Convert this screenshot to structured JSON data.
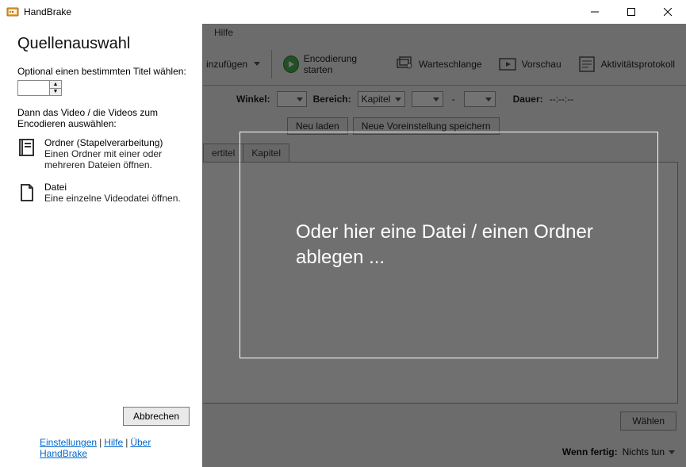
{
  "title": "HandBrake",
  "menu": {
    "help": "Hilfe"
  },
  "toolbar": {
    "open": "inzufügen",
    "encode": "Encodierung starten",
    "queue": "Warteschlange",
    "preview": "Vorschau",
    "activity": "Aktivitätsprotokoll"
  },
  "row1": {
    "angle": "Winkel:",
    "range": "Bereich:",
    "range_val": "Kapitel",
    "duration": "Dauer:",
    "duration_val": "--:--:--"
  },
  "row2": {
    "reload": "Neu laden",
    "save_preset": "Neue Voreinstellung speichern"
  },
  "tabs": {
    "subtitle": "ertitel",
    "chapters": "Kapitel"
  },
  "bottom": {
    "choose": "Wählen"
  },
  "status": {
    "label": "Wenn fertig:",
    "value": "Nichts tun"
  },
  "panel": {
    "heading": "Quellenauswahl",
    "opt_label": "Optional einen bestimmten Titel wählen:",
    "instruction": "Dann das Video / die Videos zum Encodieren auswählen:",
    "folder_t": "Ordner (Stapelverarbeitung)",
    "folder_d": "Einen Ordner mit einer oder mehreren Dateien öffnen.",
    "file_t": "Datei",
    "file_d": "Eine einzelne Videodatei öffnen.",
    "cancel": "Abbrechen",
    "link_settings": "Einstellungen",
    "link_help": "Hilfe",
    "link_about": "Über HandBrake"
  },
  "drop": {
    "message": "Oder hier eine Datei / einen Ordner ablegen ..."
  }
}
